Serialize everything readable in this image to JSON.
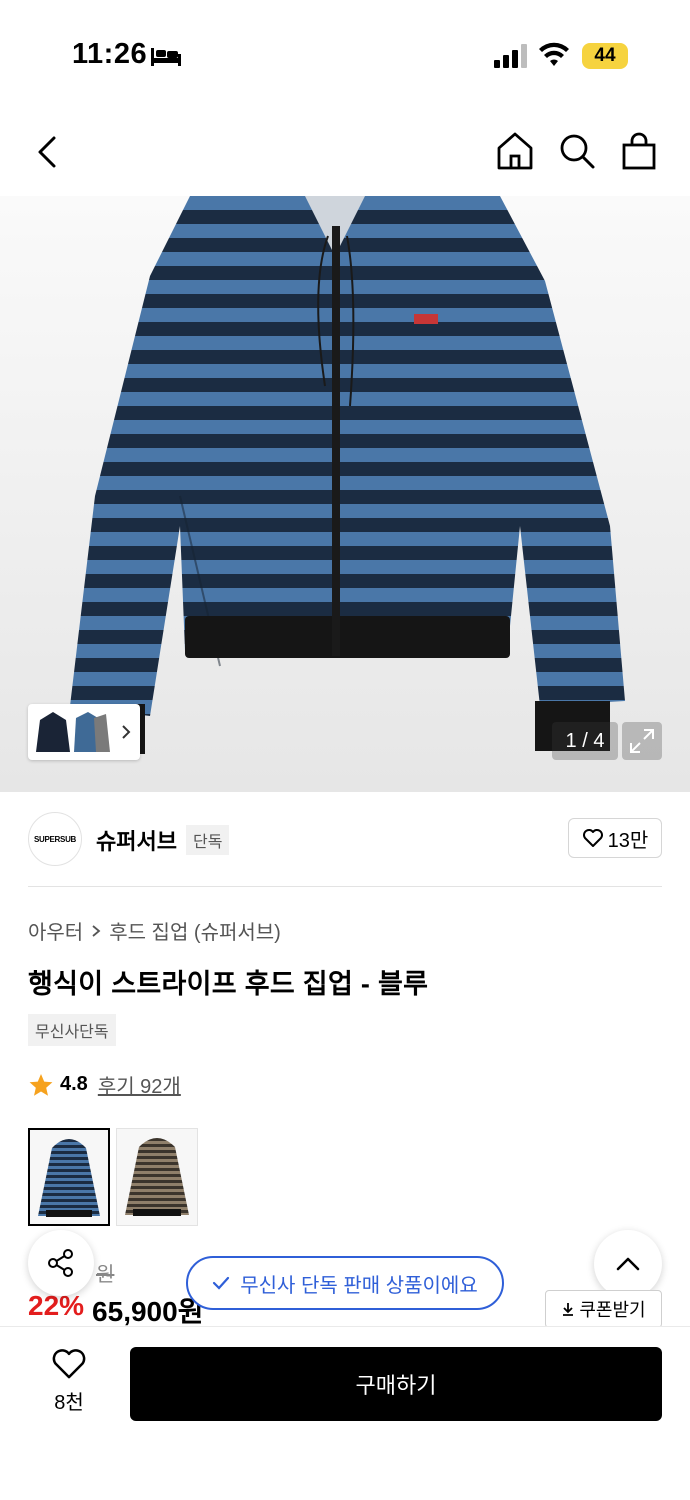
{
  "status_bar": {
    "time": "11:26",
    "battery": "44"
  },
  "image_viewer": {
    "page_counter": "1 / 4"
  },
  "brand": {
    "logo_text": "SUPERSUB",
    "name": "슈퍼서브",
    "tag": "단독",
    "like_count": "13만"
  },
  "breadcrumb": {
    "category": "아우터",
    "subcategory": "후드 집업 (슈퍼서브)"
  },
  "product": {
    "title": "행식이 스트라이프 후드 집업 - 블루",
    "badge": "무신사단독",
    "rating": "4.8",
    "reviews": "후기 92개",
    "color_options": [
      "blue",
      "brown"
    ],
    "original_price": "원",
    "discount": "22%",
    "price": "65,900원"
  },
  "toast": {
    "text": "무신사 단독 판매 상품이에요"
  },
  "coupon": {
    "label": "쿠폰받기"
  },
  "bottom_bar": {
    "wish_count": "8천",
    "buy_label": "구매하기"
  },
  "colors": {
    "accent_blue": "#2f5fd8",
    "discount_red": "#e31d1d",
    "star": "#f6a21e"
  }
}
